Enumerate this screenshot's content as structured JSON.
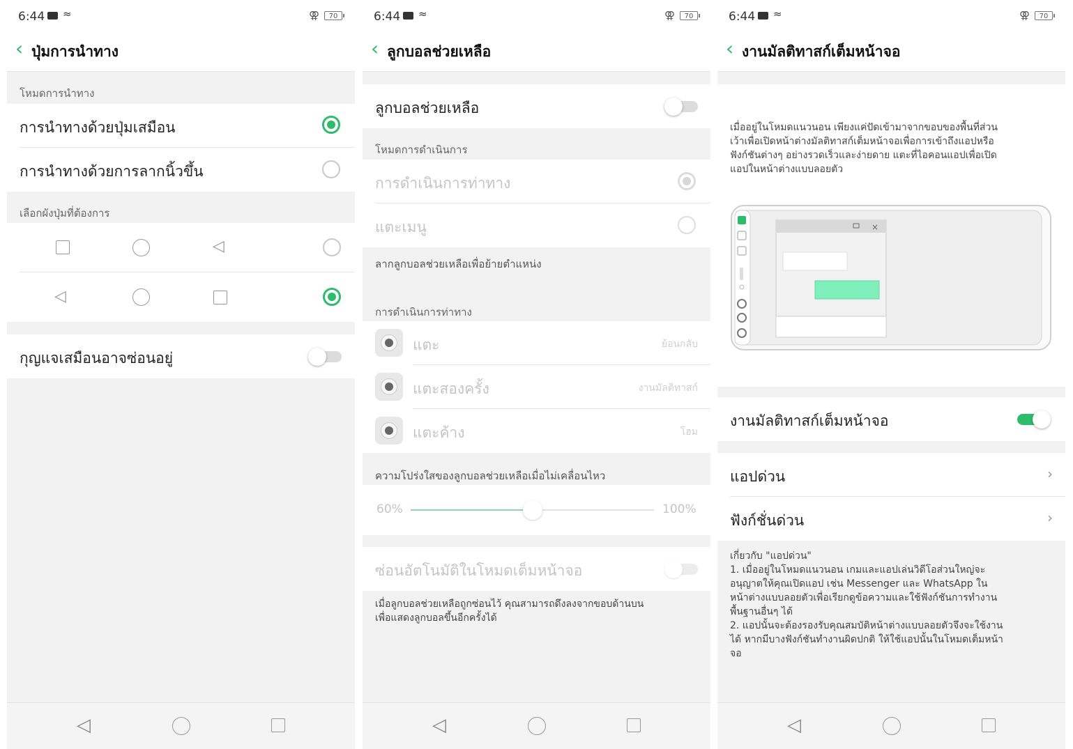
{
  "status_bar": {
    "time": "6:44",
    "battery": "70"
  },
  "screens": [
    {
      "title": "ปุ่มการนำทาง",
      "section_mode": "โหมดการนำทาง",
      "options": [
        "การนำทางด้วยปุ่มเสมือน",
        "การนำทางด้วยการลากนิ้วขึ้น"
      ],
      "selected_option": 0,
      "section_layout": "เลือกผังปุ่มที่ต้องการ",
      "layouts": [
        {
          "icons": [
            "square-icon",
            "circle-icon",
            "triangle-back-icon"
          ],
          "selected": false
        },
        {
          "icons": [
            "triangle-back-icon",
            "circle-icon",
            "square-icon"
          ],
          "selected": true
        }
      ],
      "toggle_label": "กุญแจเสมือนอาจซ่อนอยู่",
      "toggle_on": false
    },
    {
      "title": "ลูกบอลช่วยเหลือ",
      "main_toggle_label": "ลูกบอลช่วยเหลือ",
      "main_toggle_on": false,
      "section_operation_mode": "โหมดการดำเนินการ",
      "operation_modes": [
        "การดำเนินการท่าทาง",
        "แตะเมนู"
      ],
      "drag_hint": "ลากลูกบอลช่วยเหลือเพื่อย้ายตำแหน่ง",
      "section_gestures": "การดำเนินการท่าทาง",
      "gestures": [
        {
          "label": "แตะ",
          "value": "ย้อนกลับ"
        },
        {
          "label": "แตะสองครั้ง",
          "value": "งานมัลติทาสก์"
        },
        {
          "label": "แตะค้าง",
          "value": "โฮม"
        }
      ],
      "section_opacity": "ความโปร่งใสของลูกบอลช่วยเหลือเมื่อไม่เคลื่อนไหว",
      "slider_min": "60%",
      "slider_max": "100%",
      "slider_fraction": 0.5,
      "auto_hide_label": "ซ่อนอัตโนมัติในโหมดเต็มหน้าจอ",
      "auto_hide_desc": "เมื่อลูกบอลช่วยเหลือถูกซ่อนไว้ คุณสามารถดึงลงจากขอบด้านบน\nเพื่อแสดงลูกบอลขึ้นอีกครั้งได้"
    },
    {
      "title": "งานมัลติทาสก์เต็มหน้าจอ",
      "intro": "เมื่ออยู่ในโหมดแนวนอน เพียงแค่ปัดเข้ามาจากขอบของพื้นที่ส่วน\nเว้าเพื่อเปิดหน้าต่างมัลติทาสก์เต็มหน้าจอเพื่อการเข้าถึงแอปหรือ\nฟังก์ชันต่างๆ อย่างรวดเร็วและง่ายดาย แตะที่ไอคอนแอปเพื่อเปิด\nแอปในหน้าต่างแบบลอยตัว",
      "toggle_label": "งานมัลติทาสก์เต็มหน้าจอ",
      "toggle_on": true,
      "links": [
        "แอปด่วน",
        "ฟังก์ชั่นด่วน"
      ],
      "notes": "เกี่ยวกับ \"แอปด่วน\"\n1. เมื่ออยู่ในโหมดแนวนอน เกมและแอปเล่นวิดีโอส่วนใหญ่จะ\nอนุญาตให้คุณเปิดแอป เช่น Messenger และ WhatsApp ใน\nหน้าต่างแบบลอยตัวเพื่อเรียกดูข้อความและใช้ฟังก์ชันการทำงาน\nพื้นฐานอื่นๆ ได้\n2. แอปนั้นจะต้องรองรับคุณสมบัติหน้าต่างแบบลอยตัวจึงจะใช้งาน\nได้ หากมีบางฟังก์ชันทำงานผิดปกติ ให้ใช้แอปนั้นในโหมดเต็มหน้า\nจอ"
    }
  ],
  "colors": {
    "accent": "#2cbc6b",
    "background": "#f2f2f2"
  }
}
